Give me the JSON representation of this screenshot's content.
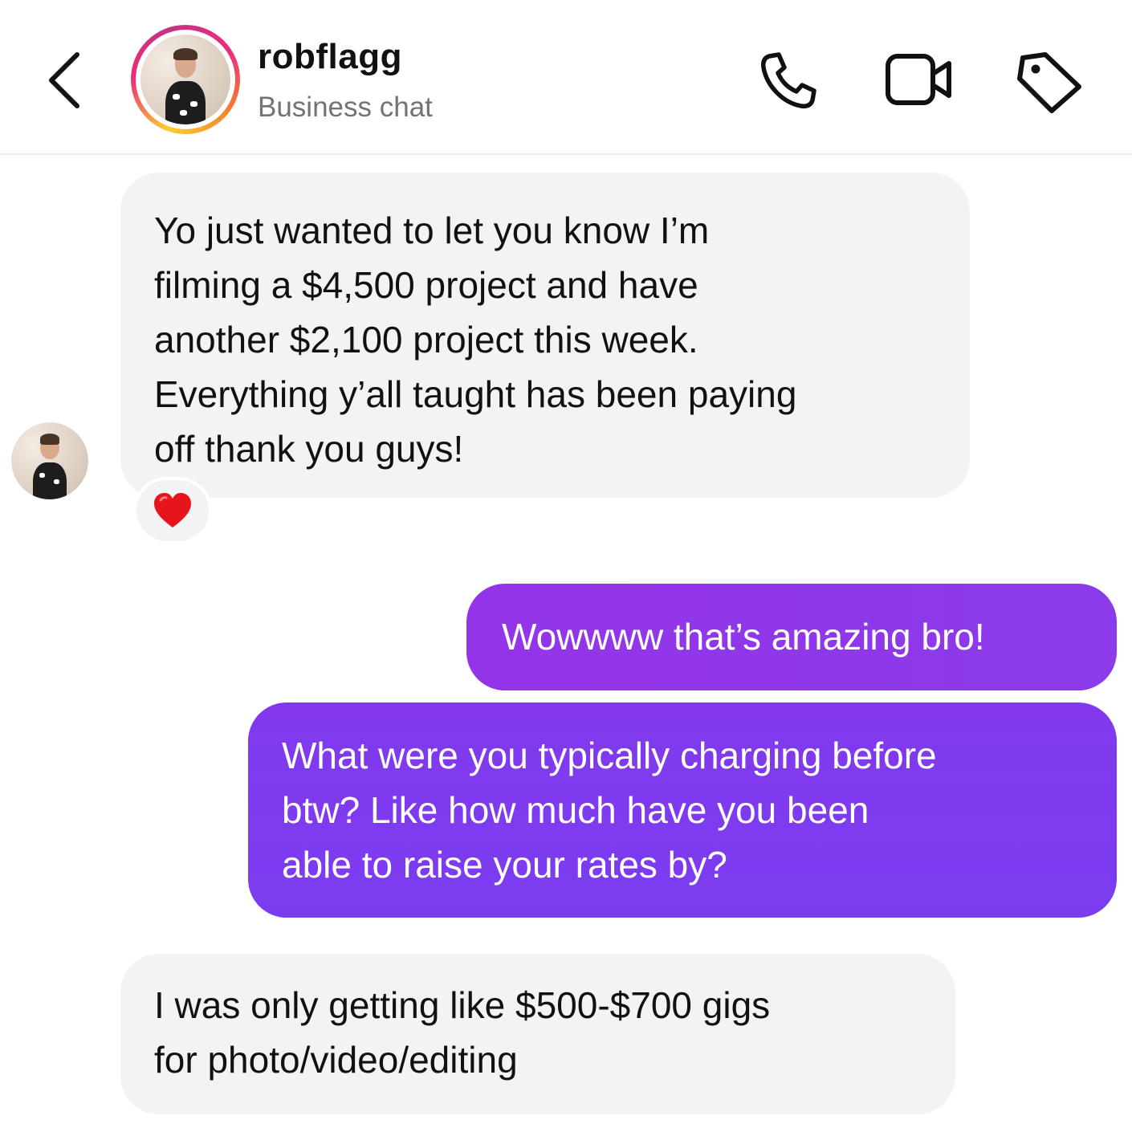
{
  "header": {
    "username": "robflagg",
    "subtitle": "Business chat",
    "icons": [
      "back-chevron",
      "phone",
      "video-camera",
      "tag"
    ]
  },
  "messages": [
    {
      "sender": "them",
      "text": "Yo just wanted to let you know I’m\nfilming a $4,500 project and have\nanother $2,100 project this week.\nEverything y’all taught has been paying\noff thank you guys!",
      "reaction": "heart"
    },
    {
      "sender": "me",
      "text": "Wowwww that’s amazing bro!"
    },
    {
      "sender": "me",
      "text": "What were you typically charging before\nbtw? Like how much have you been\nable to raise your rates by?"
    },
    {
      "sender": "them",
      "text": "I was only getting like $500-$700 gigs\nfor photo/video/editing"
    }
  ],
  "colors": {
    "outgoing_start": "#9434e8",
    "outgoing_end": "#7b3cf0",
    "incoming_bg": "#f2f3f5",
    "heart": "#e8141c"
  }
}
